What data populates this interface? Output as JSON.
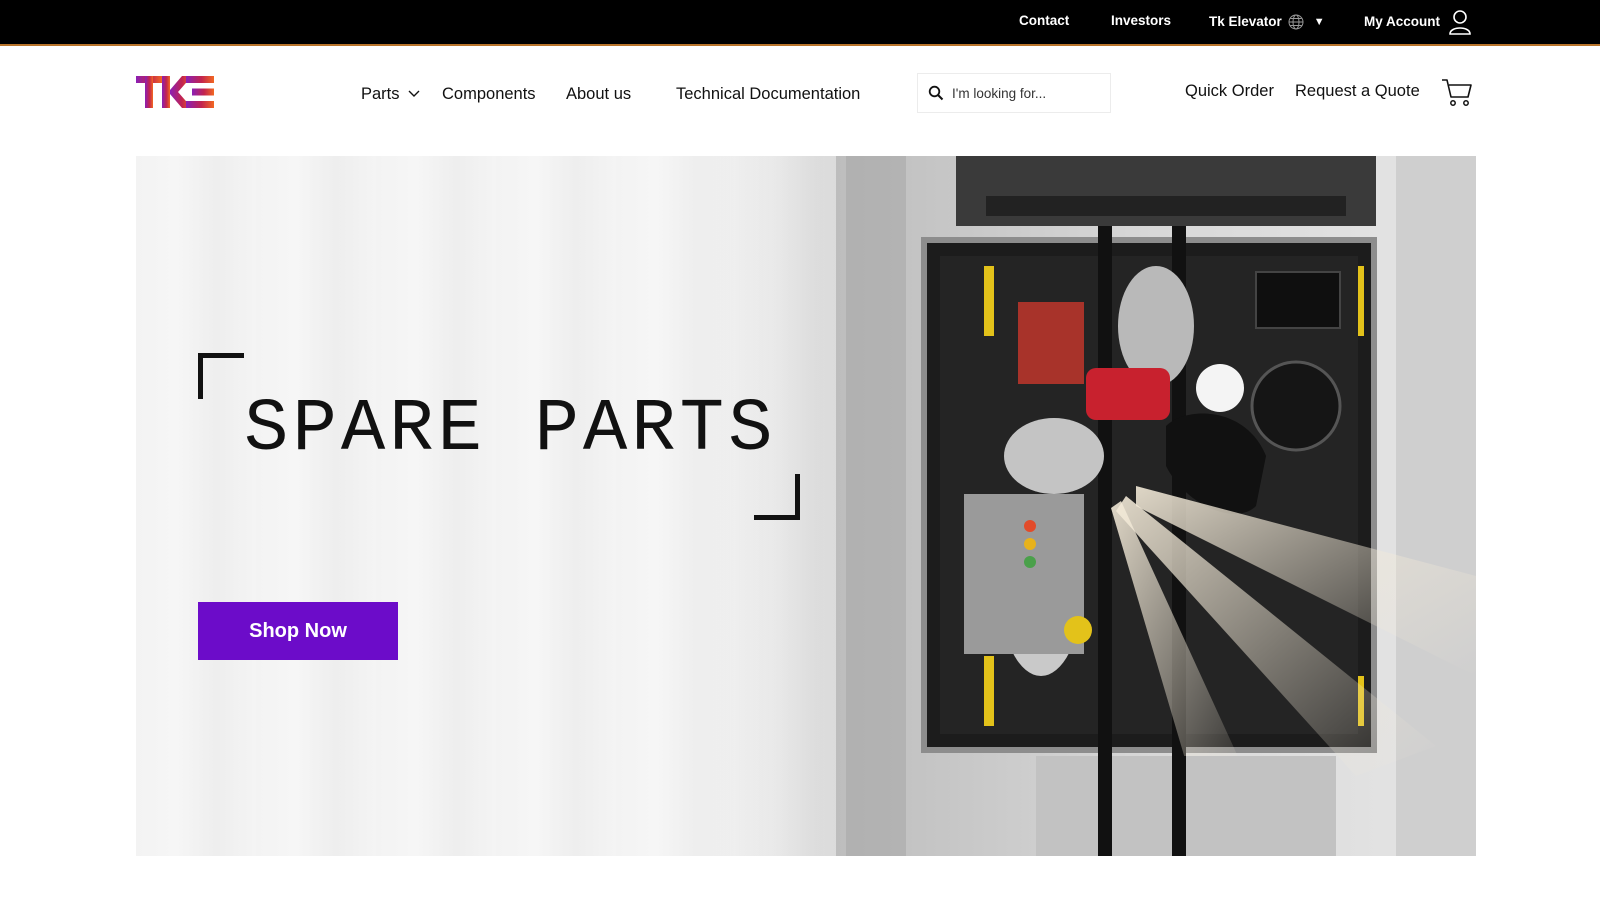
{
  "topbar": {
    "contact": "Contact",
    "investors": "Investors",
    "region": "Tk Elevator",
    "region_icon": "globe-icon",
    "account": "My Account",
    "account_icon": "user-icon",
    "background_color": "#000000"
  },
  "header": {
    "logo_text": "TKE",
    "nav": {
      "parts": "Parts",
      "components": "Components",
      "about": "About us",
      "techdoc": "Technical Documentation"
    },
    "search": {
      "placeholder": "I'm looking for...",
      "value": "",
      "icon": "search-icon"
    },
    "quick_order": "Quick Order",
    "request_quote": "Request a Quote",
    "cart_icon": "cart-icon"
  },
  "hero": {
    "title": "SPARE PARTS",
    "cta": "Shop Now",
    "cta_color": "#6c0cc9",
    "image_alt": "Technician working on top of an elevator car"
  },
  "colors": {
    "brand_purple": "#6c0cc9",
    "logo_gradient_start": "#8a1fb6",
    "logo_gradient_end": "#f26722"
  }
}
